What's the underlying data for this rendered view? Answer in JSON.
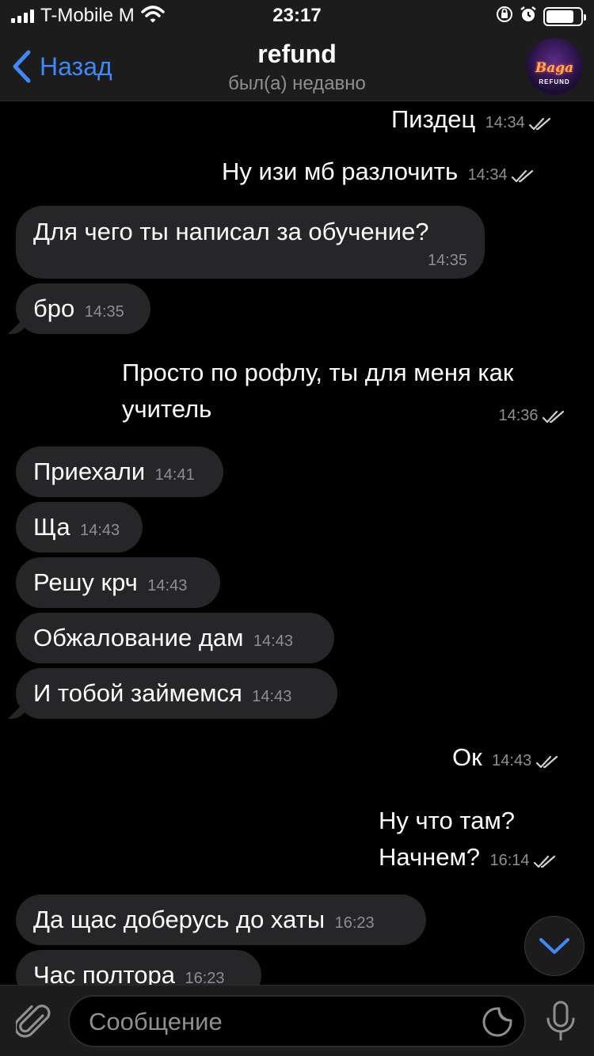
{
  "status_bar": {
    "carrier": "T-Mobile M",
    "time": "23:17",
    "battery_level": 0.8
  },
  "header": {
    "back_label": "Назад",
    "title": "refund",
    "subtitle": "был(а) недавно",
    "avatar_text": "Baga",
    "avatar_subtext": "REFUND"
  },
  "messages": [
    {
      "dir": "out",
      "text": "Пиздец",
      "time": "14:34"
    },
    {
      "dir": "out",
      "text": "Ну изи мб разлочить",
      "time": "14:34"
    },
    {
      "dir": "in",
      "text": "Для чего ты написал за обучение?",
      "time": "14:35"
    },
    {
      "dir": "in",
      "text": "бро",
      "time": "14:35"
    },
    {
      "dir": "out",
      "text": "Просто по рофлу, ты для меня как",
      "text2": "учитель",
      "time": "14:36"
    },
    {
      "dir": "in",
      "text": "Приехали",
      "time": "14:41"
    },
    {
      "dir": "in",
      "text": "Ща",
      "time": "14:43"
    },
    {
      "dir": "in",
      "text": "Решу крч",
      "time": "14:43"
    },
    {
      "dir": "in",
      "text": "Обжалование дам",
      "time": "14:43"
    },
    {
      "dir": "in",
      "text": "И тобой займемся",
      "time": "14:43"
    },
    {
      "dir": "out",
      "text": "Ок",
      "time": "14:43"
    },
    {
      "dir": "out",
      "text": "Ну что там?",
      "text2": "Начнем?",
      "time": "16:14"
    },
    {
      "dir": "in",
      "text": "Да щас доберусь до хаты",
      "time": "16:23"
    },
    {
      "dir": "in",
      "text": "Час полтора",
      "time": "16:23"
    }
  ],
  "input": {
    "placeholder": "Сообщение"
  },
  "colors": {
    "accent": "#3e88f7",
    "background": "#000000",
    "bar": "#1c1c1d",
    "incoming_bubble": "#262628",
    "secondary_text": "#8e8e93"
  }
}
